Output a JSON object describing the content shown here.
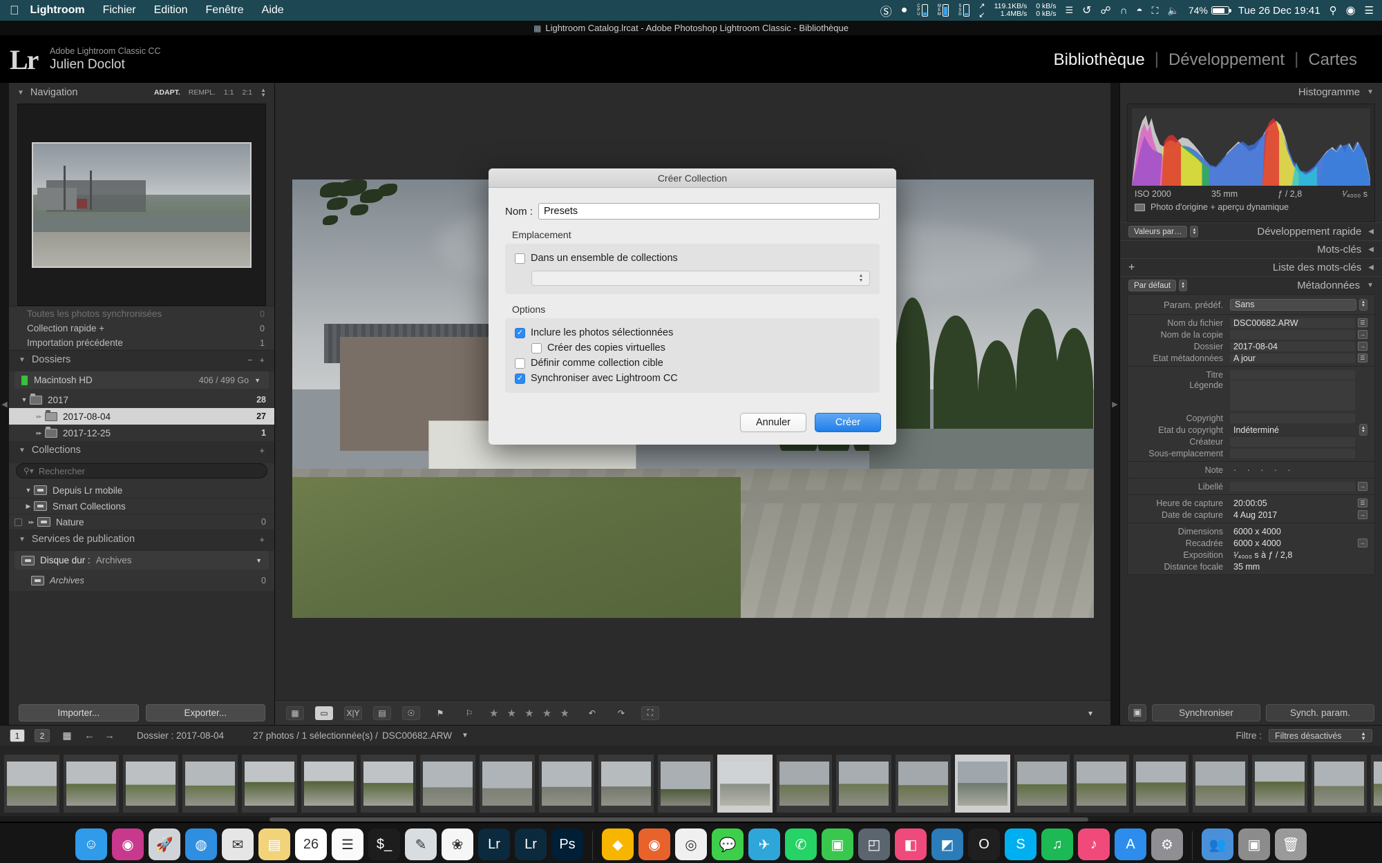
{
  "menubar": {
    "apple_icon": "apple-icon",
    "app_name": "Lightroom",
    "items": [
      "Fichier",
      "Edition",
      "Fenêtre",
      "Aide"
    ],
    "status": {
      "creative_cloud_icon": "creative-cloud-icon",
      "dropbox_icon": "dropbox-icon",
      "cpu_label": "CPU",
      "mem_label": "MEM",
      "ssd_label": "SSD",
      "net_down": "119.1KB/s",
      "net_up": "1.4MB/s",
      "net_down2": "0 kB/s",
      "net_up2": "0 kB/s",
      "time_machine_icon": "time-machine-icon",
      "bluetooth_icon": "bluetooth-icon",
      "vpn_icon": "vpn-icon",
      "wifi_icon": "wifi-icon",
      "airplay_icon": "airplay-icon",
      "volume_icon": "volume-icon",
      "battery_percent": "74%",
      "datetime": "Tue 26 Dec  19:41",
      "spotlight_icon": "search-icon",
      "siri_icon": "siri-icon",
      "notification_icon": "notification-center-icon"
    }
  },
  "window": {
    "title": "Lightroom Catalog.lrcat - Adobe Photoshop Lightroom Classic - Bibliothèque",
    "doc_icon": "document-icon"
  },
  "identity": {
    "logo": "Lr",
    "product": "Adobe Lightroom Classic CC",
    "user": "Julien Doclot"
  },
  "modules": [
    {
      "label": "Bibliothèque",
      "active": true
    },
    {
      "label": "Développement",
      "active": false
    },
    {
      "label": "Cartes",
      "active": false
    }
  ],
  "left": {
    "navigator": {
      "title": "Navigation",
      "zoom_levels": [
        "ADAPT.",
        "REMPL.",
        "1:1",
        "2:1"
      ],
      "active_zoom": "ADAPT."
    },
    "catalog_rows": [
      {
        "label": "Toutes les photos synchronisées",
        "count": "0",
        "partial": true
      },
      {
        "label": "Collection rapide +",
        "count": "0",
        "partial": false
      },
      {
        "label": "Importation précédente",
        "count": "1",
        "partial": false
      }
    ],
    "folders": {
      "title": "Dossiers",
      "minus": "−",
      "plus": "+",
      "volume": {
        "name": "Macintosh HD",
        "space": "406 / 499 Go"
      },
      "items": [
        {
          "label": "2017",
          "count": "28",
          "level": 0,
          "expanded": true,
          "selected": false
        },
        {
          "label": "2017-08-04",
          "count": "27",
          "level": 1,
          "expanded": false,
          "selected": true
        },
        {
          "label": "2017-12-25",
          "count": "1",
          "level": 1,
          "expanded": false,
          "selected": false
        }
      ]
    },
    "collections": {
      "title": "Collections",
      "plus": "+",
      "search_placeholder": "Rechercher",
      "items": [
        {
          "label": "Depuis Lr mobile",
          "count": "",
          "expanded": true,
          "checkbox": false
        },
        {
          "label": "Smart Collections",
          "count": "",
          "expanded": false,
          "checkbox": false
        },
        {
          "label": "Nature",
          "count": "0",
          "expanded": false,
          "checkbox": true
        }
      ]
    },
    "publish": {
      "title": "Services de publication",
      "plus": "+",
      "service_label": "Disque dur :",
      "service_value": "Archives",
      "children": [
        {
          "label": "Archives",
          "count": "0"
        }
      ]
    },
    "buttons": {
      "import": "Importer...",
      "export": "Exporter..."
    }
  },
  "toolbar": {
    "grid_icon": "grid-view-icon",
    "loupe_icon": "loupe-view-icon",
    "compare_icon": "compare-view-icon",
    "survey_icon": "survey-view-icon",
    "people_icon": "people-view-icon",
    "flag_icon": "flag-icon",
    "reject_icon": "reject-flag-icon",
    "stars": "★ ★ ★ ★ ★",
    "rotate_left_icon": "rotate-left-icon",
    "rotate_right_icon": "rotate-right-icon",
    "crop_overlay_icon": "crop-overlay-icon",
    "chevron_icon": "chevron-down-icon"
  },
  "right": {
    "histogram": {
      "title": "Histogramme",
      "iso": "ISO 2000",
      "focal": "35 mm",
      "aperture": "ƒ / 2,8",
      "shutter": "¹⁄₄₀₀₀ s",
      "preview_note": "Photo d'origine + aperçu dynamique"
    },
    "quick_develop": {
      "title": "Développement rapide",
      "preset_button": "Valeurs par…"
    },
    "keywords": {
      "title": "Mots-clés"
    },
    "keyword_list": {
      "title": "Liste des mots-clés",
      "plus": "+"
    },
    "metadata": {
      "title": "Métadonnées",
      "view_select": "Par défaut",
      "preset_label": "Param. prédéf.",
      "preset_value": "Sans",
      "fields": [
        {
          "label": "Nom du fichier",
          "value": "DSC00682.ARW",
          "btn": "list"
        },
        {
          "label": "Nom de la copie",
          "value": "",
          "btn": "arrow"
        },
        {
          "label": "Dossier",
          "value": "2017-08-04",
          "btn": "arrow"
        },
        {
          "label": "Etat métadonnées",
          "value": "A jour",
          "btn": "list"
        }
      ],
      "fields2": [
        {
          "label": "Titre",
          "value": "",
          "btn": ""
        },
        {
          "label": "Légende",
          "value": "",
          "btn": "",
          "tall": true
        },
        {
          "label": "Copyright",
          "value": "",
          "btn": ""
        },
        {
          "label": "Etat du copyright",
          "value": "Indéterminé",
          "btn": "stepper"
        },
        {
          "label": "Créateur",
          "value": "",
          "btn": ""
        },
        {
          "label": "Sous-emplacement",
          "value": "",
          "btn": ""
        }
      ],
      "rating_label": "Note",
      "rating_dots": "·   ·   ·   ·   ·",
      "fields3": [
        {
          "label": "Libellé",
          "value": "",
          "btn": "arrow"
        }
      ],
      "fields4": [
        {
          "label": "Heure de capture",
          "value": "20:00:05",
          "btn": "list"
        },
        {
          "label": "Date de capture",
          "value": "4 Aug 2017",
          "btn": "arrow"
        }
      ],
      "fields5": [
        {
          "label": "Dimensions",
          "value": "6000 x 4000",
          "btn": ""
        },
        {
          "label": "Recadrée",
          "value": "6000 x 4000",
          "btn": "arrow"
        },
        {
          "label": "Exposition",
          "value": "¹⁄₄₀₀₀ s à ƒ / 2,8",
          "btn": ""
        },
        {
          "label": "Distance focale",
          "value": "35 mm",
          "btn": ""
        }
      ]
    },
    "buttons": {
      "sync": "Synchroniser",
      "sync_params": "Synch. param."
    }
  },
  "filmbar": {
    "page1": "1",
    "page2": "2",
    "grid_icon": "grid-icon",
    "back_icon": "back-arrow-icon",
    "forward_icon": "forward-arrow-icon",
    "path": "Dossier : 2017-08-04",
    "status": "27 photos / 1 sélectionnée(s) /",
    "filename": "DSC00682.ARW",
    "chevron": "chevron-down-icon",
    "filter_label": "Filtre :",
    "filter_value": "Filtres désactivés"
  },
  "dialog": {
    "title": "Créer Collection",
    "name_label": "Nom :",
    "name_value": "Presets",
    "location_label": "Emplacement",
    "inside_set_label": "Dans un ensemble de collections",
    "inside_set_checked": false,
    "set_select_value": "",
    "options_label": "Options",
    "options": [
      {
        "label": "Inclure les photos sélectionnées",
        "checked": true,
        "indent": false
      },
      {
        "label": "Créer des copies virtuelles",
        "checked": false,
        "indent": true
      },
      {
        "label": "Définir comme collection cible",
        "checked": false,
        "indent": false
      },
      {
        "label": "Synchroniser avec Lightroom CC",
        "checked": true,
        "indent": false
      }
    ],
    "cancel": "Annuler",
    "create": "Créer",
    "accent_color": "#2b8bf3"
  },
  "dock": {
    "items": [
      {
        "name": "finder",
        "glyph": "☺",
        "bg": "#2f9bea"
      },
      {
        "name": "siri",
        "glyph": "◉",
        "bg": "#c8388c"
      },
      {
        "name": "launchpad",
        "glyph": "🚀",
        "bg": "#d0d4d8"
      },
      {
        "name": "safari",
        "glyph": "◍",
        "bg": "#2e8fe0"
      },
      {
        "name": "mail",
        "glyph": "✉",
        "bg": "#e6e6e6"
      },
      {
        "name": "notes",
        "glyph": "▤",
        "bg": "#f2d37a"
      },
      {
        "name": "calendar",
        "glyph": "26",
        "bg": "#ffffff"
      },
      {
        "name": "reminders",
        "glyph": "☰",
        "bg": "#fafafa"
      },
      {
        "name": "terminal",
        "glyph": "$_",
        "bg": "#1d1d1d"
      },
      {
        "name": "preview",
        "glyph": "✎",
        "bg": "#d8dde2"
      },
      {
        "name": "photos",
        "glyph": "❀",
        "bg": "#f6f6f6"
      },
      {
        "name": "lightroom-cc",
        "glyph": "Lr",
        "bg": "#0b2a3d"
      },
      {
        "name": "lightroom-classic",
        "glyph": "Lr",
        "bg": "#0b2a3d"
      },
      {
        "name": "photoshop",
        "glyph": "Ps",
        "bg": "#001e36"
      },
      {
        "name": "sketch",
        "glyph": "◆",
        "bg": "#f7b500"
      },
      {
        "name": "firefox",
        "glyph": "◉",
        "bg": "#e8622c"
      },
      {
        "name": "chrome",
        "glyph": "◎",
        "bg": "#f0f0f0"
      },
      {
        "name": "messages",
        "glyph": "💬",
        "bg": "#3ecf4a"
      },
      {
        "name": "telegram",
        "glyph": "✈",
        "bg": "#2ea6da"
      },
      {
        "name": "whatsapp",
        "glyph": "✆",
        "bg": "#25d366"
      },
      {
        "name": "facetime",
        "glyph": "▣",
        "bg": "#39c84e"
      },
      {
        "name": "box",
        "glyph": "◰",
        "bg": "#5b6570"
      },
      {
        "name": "sublime",
        "glyph": "◧",
        "bg": "#ef4a7b"
      },
      {
        "name": "vscode",
        "glyph": "◩",
        "bg": "#2b7cb9"
      },
      {
        "name": "opera",
        "glyph": "O",
        "bg": "#1f1f1f"
      },
      {
        "name": "skype",
        "glyph": "S",
        "bg": "#00aff0"
      },
      {
        "name": "spotify",
        "glyph": "♫",
        "bg": "#1db954"
      },
      {
        "name": "itunes",
        "glyph": "♪",
        "bg": "#f04a7b"
      },
      {
        "name": "appstore",
        "glyph": "A",
        "bg": "#2c8ded"
      },
      {
        "name": "system-preferences",
        "glyph": "⚙",
        "bg": "#8e8e93"
      },
      {
        "name": "users",
        "glyph": "👥",
        "bg": "#4a90d9"
      },
      {
        "name": "downloads",
        "glyph": "▣",
        "bg": "#8c8c8c"
      },
      {
        "name": "trash",
        "glyph": "🗑",
        "bg": "#9a9a9a"
      }
    ]
  }
}
